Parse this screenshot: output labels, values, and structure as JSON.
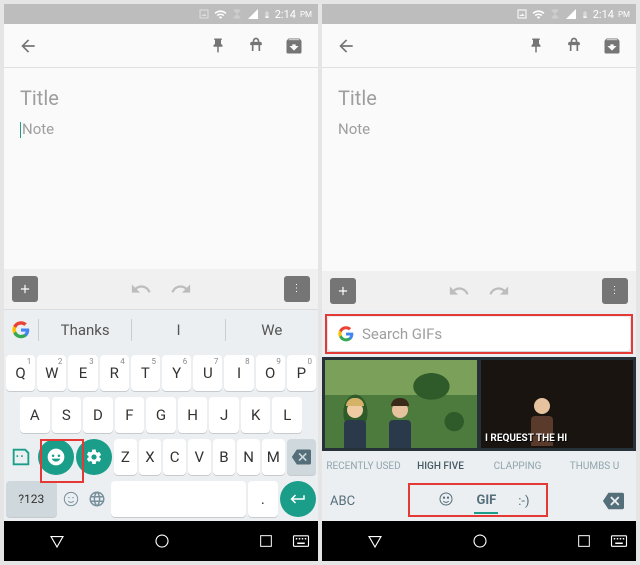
{
  "status": {
    "time": "2:14",
    "period": "PM"
  },
  "app": {
    "title_placeholder": "Title",
    "note_placeholder": "Note"
  },
  "left": {
    "suggestions": [
      "Thanks",
      "I",
      "We"
    ],
    "row1": [
      {
        "k": "Q",
        "s": "1"
      },
      {
        "k": "W",
        "s": "2"
      },
      {
        "k": "E",
        "s": "3"
      },
      {
        "k": "R",
        "s": "4"
      },
      {
        "k": "T",
        "s": "5"
      },
      {
        "k": "Y",
        "s": "6"
      },
      {
        "k": "U",
        "s": "7"
      },
      {
        "k": "I",
        "s": "8"
      },
      {
        "k": "O",
        "s": "9"
      },
      {
        "k": "P",
        "s": "0"
      }
    ],
    "row2": [
      "A",
      "S",
      "D",
      "F",
      "G",
      "H",
      "J",
      "K",
      "L"
    ],
    "row3": [
      "Z",
      "X",
      "C",
      "V",
      "B",
      "N",
      "M"
    ],
    "sym_key": "?123"
  },
  "right": {
    "search_placeholder": "Search GIFs",
    "gif_caption": "I REQUEST THE HI",
    "categories": [
      "RECENTLY USED",
      "HIGH FIVE",
      "CLAPPING",
      "THUMBS U"
    ],
    "active_category": "HIGH FIVE",
    "abc_label": "ABC",
    "gif_label": "GIF",
    "emoticon_label": ":-)"
  }
}
